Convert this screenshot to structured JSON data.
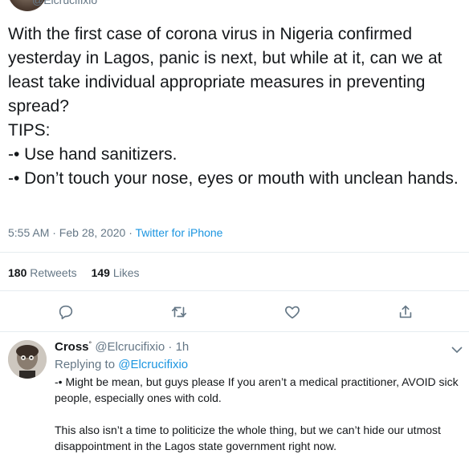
{
  "top": {
    "handle": "@Elcrucifixio"
  },
  "tweet": {
    "text": "With the first case of corona virus in Nigeria confirmed yesterday in Lagos, panic is next, but while at it, can we at least take individual appropriate measures in preventing spread?\nTIPS:\n-• Use hand sanitizers.\n-• Don’t touch your nose, eyes or mouth with unclean hands.",
    "time": "5:55 AM · Feb 28, 2020",
    "separator": " · ",
    "source": "Twitter for iPhone"
  },
  "stats": {
    "retweets_count": "180",
    "retweets_label": "Retweets",
    "likes_count": "149",
    "likes_label": "Likes"
  },
  "actions": {
    "icons": [
      "reply-icon",
      "retweet-icon",
      "like-icon",
      "share-icon"
    ]
  },
  "reply": {
    "name": "Cross",
    "badge": "°",
    "handle": "@Elcrucifixio",
    "time": "1h",
    "replying_prefix": "Replying to",
    "replying_handle": "@Elcrucifixio",
    "text": "-• Might be mean, but guys please If you aren’t a medical practitioner, AVOID sick people, especially ones with cold.\n\nThis also isn’t a time to politicize the whole thing, but we can’t hide our utmost disappointment in the Lagos state government right now."
  },
  "colors": {
    "text": "#14171a",
    "secondary": "#657786",
    "link": "#1b95e0",
    "divider": "#e6ecf0"
  }
}
